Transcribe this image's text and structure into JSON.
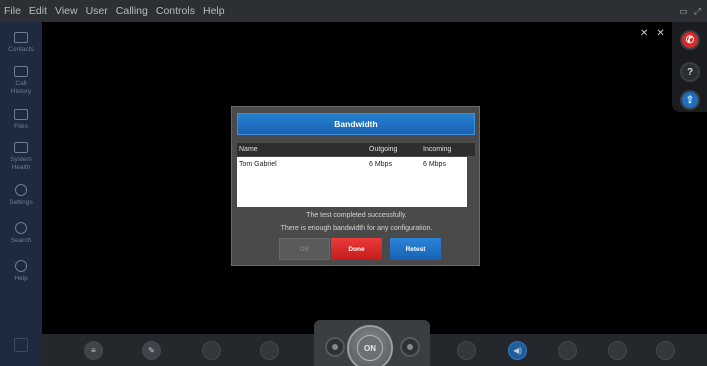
{
  "menu": [
    "File",
    "Edit",
    "View",
    "User",
    "Calling",
    "Controls",
    "Help"
  ],
  "sidebar": {
    "items": [
      {
        "label": "Contacts",
        "icon": "contacts-icon"
      },
      {
        "label": "Call\nHistory",
        "icon": "call-history-icon"
      },
      {
        "label": "Files",
        "icon": "files-icon"
      },
      {
        "label": "System\nHealth",
        "icon": "system-health-icon"
      },
      {
        "label": "Settings",
        "icon": "settings-icon"
      },
      {
        "label": "Search",
        "icon": "search-icon"
      },
      {
        "label": "Help",
        "icon": "help-icon"
      }
    ]
  },
  "dialog": {
    "title": "Bandwidth",
    "columns": [
      "Name",
      "Outgoing",
      "Incoming"
    ],
    "rows": [
      [
        "Tom Gabriel",
        "6 Mbps",
        "6 Mbps"
      ]
    ],
    "message1": "The test completed successfully.",
    "message2": "There is enough bandwidth for any configuration.",
    "buttons": {
      "ok": "OK",
      "done": "Done",
      "retest": "Retest"
    }
  },
  "bottom": {
    "on_label": "ON"
  },
  "colors": {
    "accent_blue": "#1f6fbf",
    "danger_red": "#d42b2b",
    "sidebar_bg": "#1e2a3d"
  }
}
